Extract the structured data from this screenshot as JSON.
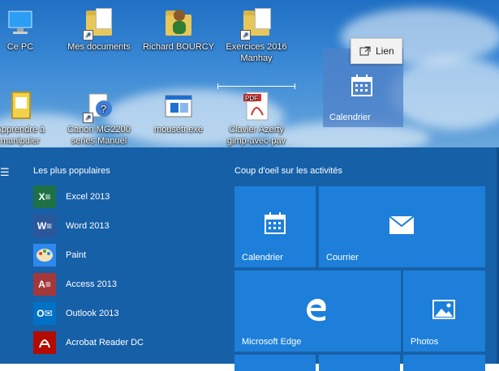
{
  "desktop": {
    "icons": [
      {
        "label": "Ce PC",
        "icon": "computer-icon"
      },
      {
        "label": "Mes documents",
        "icon": "folder-icon"
      },
      {
        "label": "Richard BOURCY",
        "icon": "user-folder-icon"
      },
      {
        "label": "Exercices 2016",
        "label2": "Manhay",
        "icon": "folder-icon"
      },
      {
        "label": "Apprendre à",
        "label2": "manipuler",
        "icon": "document-icon"
      },
      {
        "label": "Canon MG2200",
        "label2": "series Manuel",
        "icon": "help-icon"
      },
      {
        "label": "mousetr.exe",
        "icon": "exe-icon"
      },
      {
        "label": "Clavier Azerty",
        "label2": "gimp-avec-pav",
        "icon": "pdf-icon"
      }
    ],
    "dragged_tile": {
      "label": "Calendrier"
    },
    "tooltip": {
      "label": "Lien"
    }
  },
  "start_menu": {
    "most_used_title": "Les plus populaires",
    "apps": [
      {
        "label": "Excel 2013",
        "color": "#1e7145",
        "glyph": "X"
      },
      {
        "label": "Word 2013",
        "color": "#2b579a",
        "glyph": "W"
      },
      {
        "label": "Paint",
        "color": "#2d89ef",
        "glyph": "🎨"
      },
      {
        "label": "Access 2013",
        "color": "#a4373a",
        "glyph": "A"
      },
      {
        "label": "Outlook 2013",
        "color": "#0072c6",
        "glyph": "O"
      },
      {
        "label": "Acrobat Reader DC",
        "color": "#b30b00",
        "glyph": "A"
      }
    ],
    "activity_title": "Coup d'oeil sur les activités",
    "tiles": [
      {
        "label": "Calendrier",
        "icon": "calendar-icon"
      },
      {
        "label": "Courrier",
        "icon": "mail-icon"
      },
      {
        "label": "Microsoft Edge",
        "icon": "edge-icon"
      },
      {
        "label": "Photos",
        "icon": "photos-icon"
      }
    ]
  }
}
